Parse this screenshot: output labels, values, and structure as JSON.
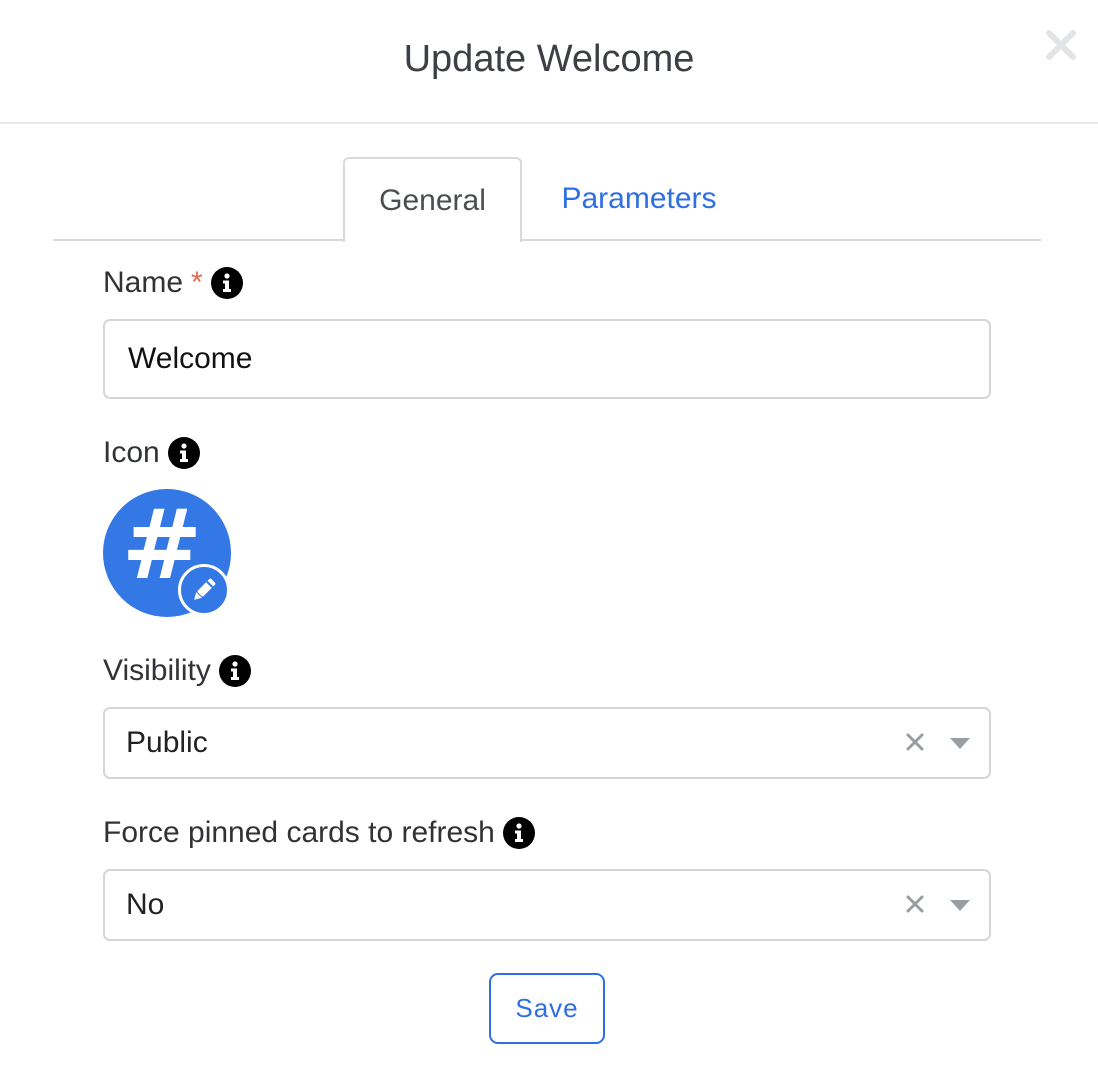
{
  "modal": {
    "title": "Update Welcome",
    "close_icon": "close-icon"
  },
  "tabs": [
    {
      "label": "General",
      "active": true
    },
    {
      "label": "Parameters",
      "active": false
    }
  ],
  "form": {
    "name": {
      "label": "Name",
      "required_mark": "*",
      "value": "Welcome",
      "info_icon": "info-icon"
    },
    "icon": {
      "label": "Icon",
      "info_icon": "info-icon",
      "glyph": "#",
      "edit_icon": "pencil-icon",
      "color": "#3478e6"
    },
    "visibility": {
      "label": "Visibility",
      "info_icon": "info-icon",
      "value": "Public",
      "clear_icon": "clear-icon",
      "caret_icon": "chevron-down-icon"
    },
    "force_refresh": {
      "label": "Force pinned cards to refresh",
      "info_icon": "info-icon",
      "value": "No",
      "clear_icon": "clear-icon",
      "caret_icon": "chevron-down-icon"
    }
  },
  "actions": {
    "save_label": "Save"
  },
  "colors": {
    "accent": "#2f6fe4",
    "required": "#e06b55",
    "border": "#d4d6d9"
  }
}
